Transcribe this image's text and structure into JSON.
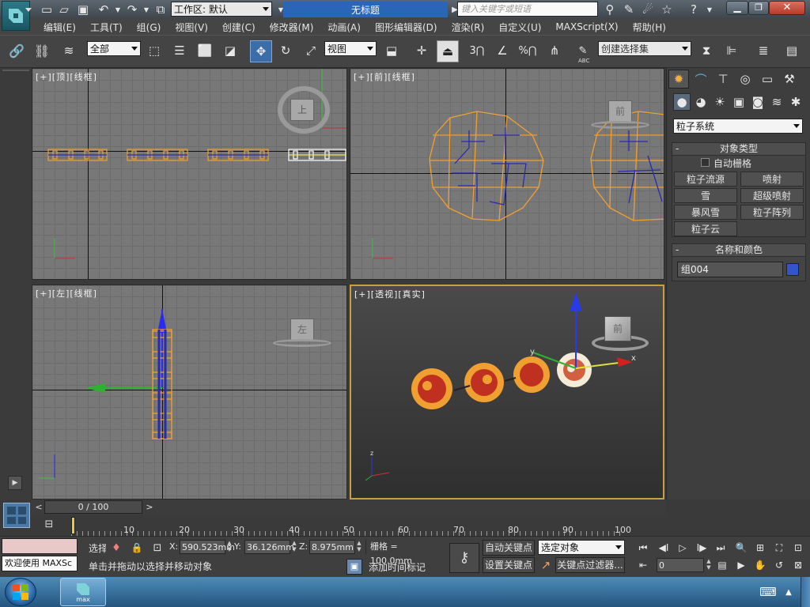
{
  "window": {
    "workspace_label": "工作区: 默认",
    "title": "无标题",
    "search_placeholder": "键入关键字或短语"
  },
  "menu": [
    "编辑(E)",
    "工具(T)",
    "组(G)",
    "视图(V)",
    "创建(C)",
    "修改器(M)",
    "动画(A)",
    "图形编辑器(D)",
    "渲染(R)",
    "自定义(U)",
    "MAXScript(X)",
    "帮助(H)"
  ],
  "toolbar": {
    "selection_filter": "全部",
    "ref_coord": "视图",
    "named_selection": "创建选择集",
    "snap_3": "3",
    "snap_percent": "%",
    "abc_label": "ABC"
  },
  "viewports": {
    "top": {
      "label": "[+][顶][线框]",
      "cube": "上"
    },
    "front": {
      "label": "[+][前][线框]",
      "cube": "前"
    },
    "left": {
      "label": "[+][左][线框]",
      "cube": "左"
    },
    "persp": {
      "label": "[+][透视][真实]",
      "cube": "前",
      "axis_x": "x",
      "axis_y": "y",
      "axis_z": "z"
    }
  },
  "cmdpanel": {
    "category": "粒子系统",
    "object_type_title": "对象类型",
    "auto_grid": "自动栅格",
    "buttons": [
      "粒子流源",
      "喷射",
      "雪",
      "超级喷射",
      "暴风雪",
      "粒子阵列",
      "粒子云"
    ],
    "name_color_title": "名称和颜色",
    "object_name": "组004",
    "object_color": "#3355cc"
  },
  "timeline": {
    "frame": "0 / 100",
    "ticks": [
      "10",
      "20",
      "30",
      "40",
      "50",
      "60",
      "70",
      "80",
      "90",
      "100"
    ]
  },
  "status": {
    "welcome": "欢迎使用 MAXSc",
    "select_label": "选择",
    "x_label": "X:",
    "x": "590.523mm",
    "y_label": "Y:",
    "y": "36.126mm",
    "z_label": "Z:",
    "z": "8.975mm",
    "grid": "栅格 = 100.0mm",
    "prompt": "单击并拖动以选择并移动对象",
    "add_time_tag": "添加时间标记",
    "auto_key": "自动关键点",
    "set_key": "设置关键点",
    "key_target": "选定对象",
    "key_filters": "关键点过滤器...",
    "frame_field": "0"
  },
  "taskbar": {
    "app_label": "max"
  },
  "colors": {
    "selection_orange": "#f0a030",
    "object_blue": "#2a2ab0",
    "active_border": "#c8a040"
  }
}
